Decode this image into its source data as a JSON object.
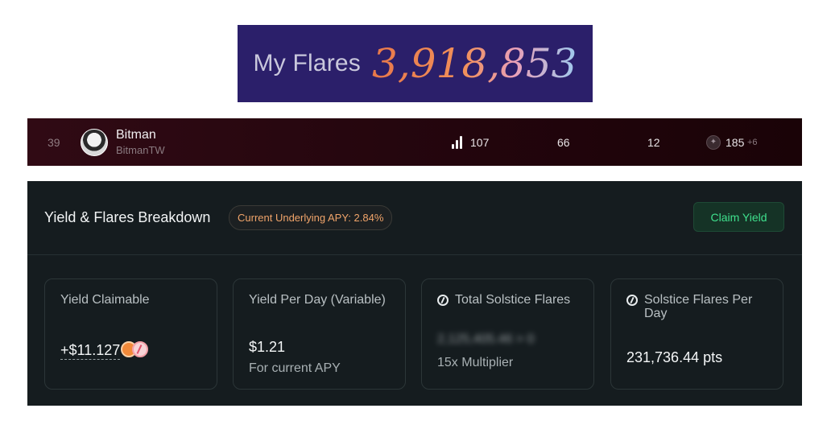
{
  "banner": {
    "label": "My Flares",
    "value": "3,918,853"
  },
  "leaderboard_row": {
    "rank": "39",
    "name": "Bitman",
    "handle": "BitmanTW",
    "stat_1": "107",
    "stat_2": "66",
    "stat_3": "12",
    "stat_4": "185",
    "stat_4_extra": "+6",
    "icons": [
      "avatar",
      "bar-chart-icon",
      "badge-icon"
    ]
  },
  "yield_panel": {
    "title": "Yield & Flares Breakdown",
    "apy_pill": "Current Underlying APY: 2.84%",
    "claim_button": "Claim Yield",
    "cards": {
      "claimable": {
        "label": "Yield Claimable",
        "value": "+$11.127"
      },
      "per_day": {
        "label": "Yield Per Day (Variable)",
        "value": "$1.21",
        "sub": "For current APY"
      },
      "total_flares": {
        "label": "Total Solstice Flares",
        "value_hidden": "2,125,405.46 > 0",
        "sub": "15x Multiplier"
      },
      "flares_per_day": {
        "label": "Solstice Flares Per Day",
        "value": "231,736.44 pts"
      }
    },
    "colors": {
      "panel_bg": "#151c1f",
      "apy_text": "#f0a46a",
      "claim_text": "#3fe08d",
      "claim_bg": "#153326"
    }
  }
}
